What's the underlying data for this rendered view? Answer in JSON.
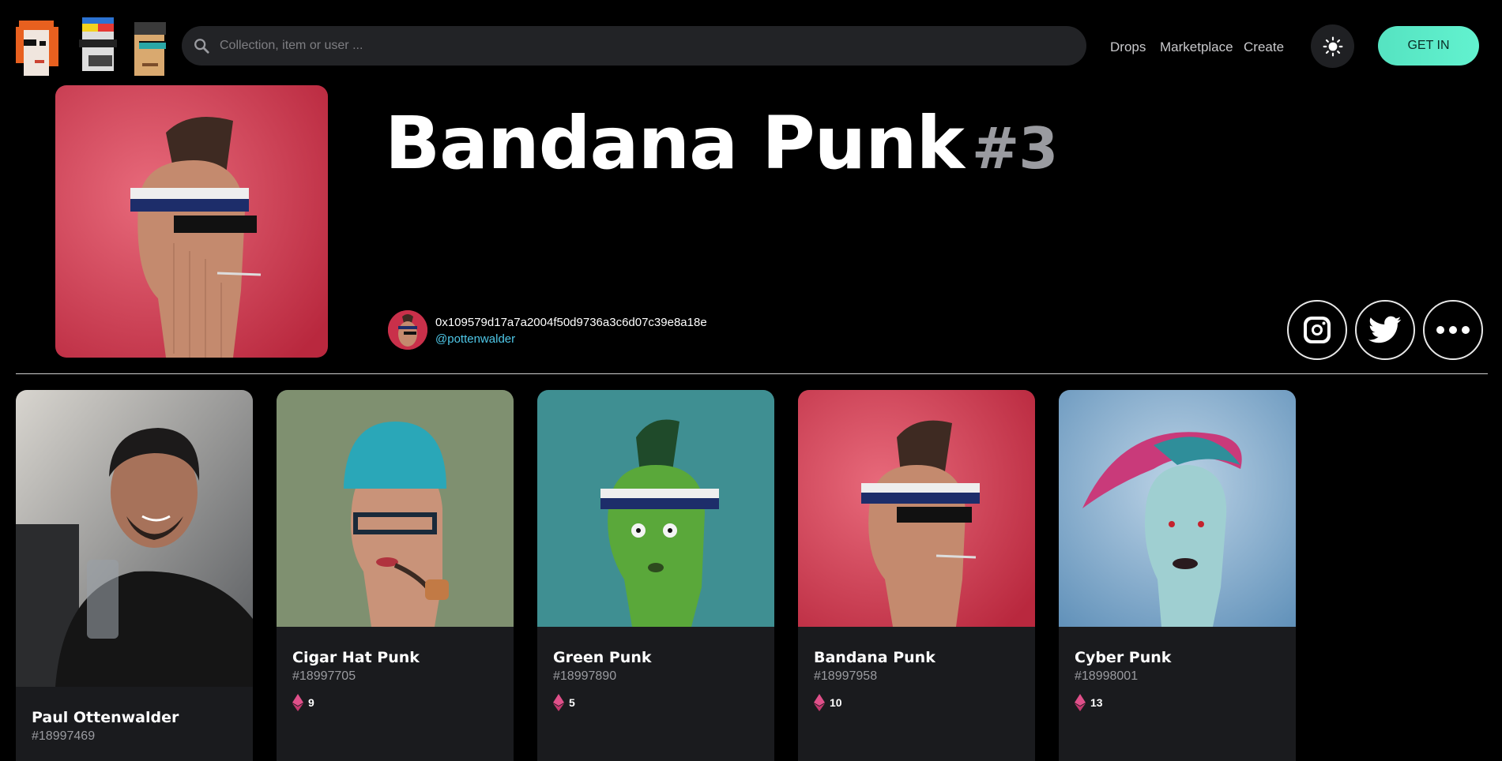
{
  "header": {
    "search_placeholder": "Collection, item or user ...",
    "nav": [
      "Drops",
      "Marketplace",
      "Create"
    ],
    "cta_label": "GET IN"
  },
  "hero": {
    "title": "Bandana Punk",
    "number": "#3",
    "owner_address": "0x109579d17a7a2004f50d9736a3c6d07c39e8a18e",
    "owner_handle": "@pottenwalder",
    "social": [
      "instagram-icon",
      "twitter-icon",
      "more-icon"
    ]
  },
  "cards": [
    {
      "name": "Paul Ottenwalder",
      "id": "#18997469",
      "price": "",
      "bg": "#6b6f73"
    },
    {
      "name": "Cigar Hat Punk",
      "id": "#18997705",
      "price": "9",
      "bg": "#7f9070"
    },
    {
      "name": "Green Punk",
      "id": "#18997890",
      "price": "5",
      "bg": "#3f8f92"
    },
    {
      "name": "Bandana Punk",
      "id": "#18997958",
      "price": "10",
      "bg": "#c8344c"
    },
    {
      "name": "Cyber Punk",
      "id": "#18998001",
      "price": "13",
      "bg": "#7faed2"
    }
  ],
  "colors": {
    "accent": "#5eeec9",
    "link": "#4fc8e8",
    "eth": "#e0508a"
  }
}
